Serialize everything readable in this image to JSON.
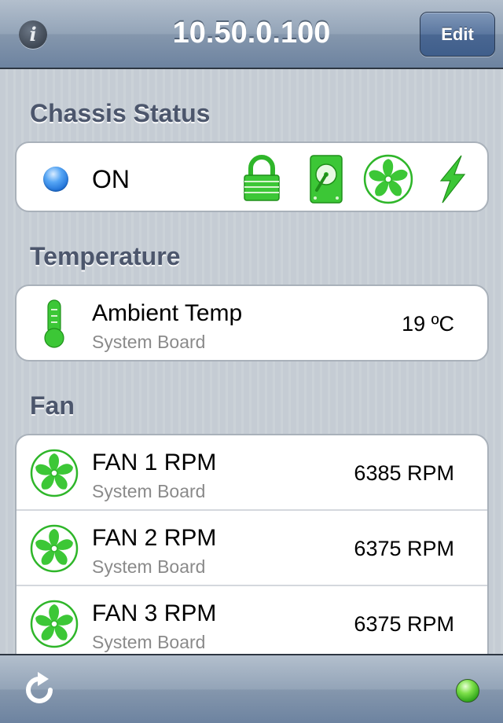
{
  "navbar": {
    "info_icon": "info-icon",
    "title": "10.50.0.100",
    "edit_label": "Edit"
  },
  "sections": {
    "chassis": "Chassis Status",
    "temperature": "Temperature",
    "fan": "Fan"
  },
  "chassis": {
    "power_state": "ON",
    "icons": [
      "lock-icon",
      "hard-drive-icon",
      "fan-icon",
      "lightning-icon"
    ],
    "status_color": "#33c12b",
    "power_dot_color": "#1d6fd6"
  },
  "temperature": [
    {
      "name": "Ambient Temp",
      "location": "System Board",
      "value": "19 ºC",
      "icon": "thermometer-icon"
    }
  ],
  "fans": [
    {
      "name": "FAN 1 RPM",
      "location": "System Board",
      "value": "6385 RPM",
      "icon": "fan-icon"
    },
    {
      "name": "FAN 2 RPM",
      "location": "System Board",
      "value": "6375 RPM",
      "icon": "fan-icon"
    },
    {
      "name": "FAN 3 RPM",
      "location": "System Board",
      "value": "6375 RPM",
      "icon": "fan-icon"
    }
  ],
  "toolbar": {
    "refresh_icon": "refresh-icon",
    "connection_status_color": "#2fa61a"
  }
}
